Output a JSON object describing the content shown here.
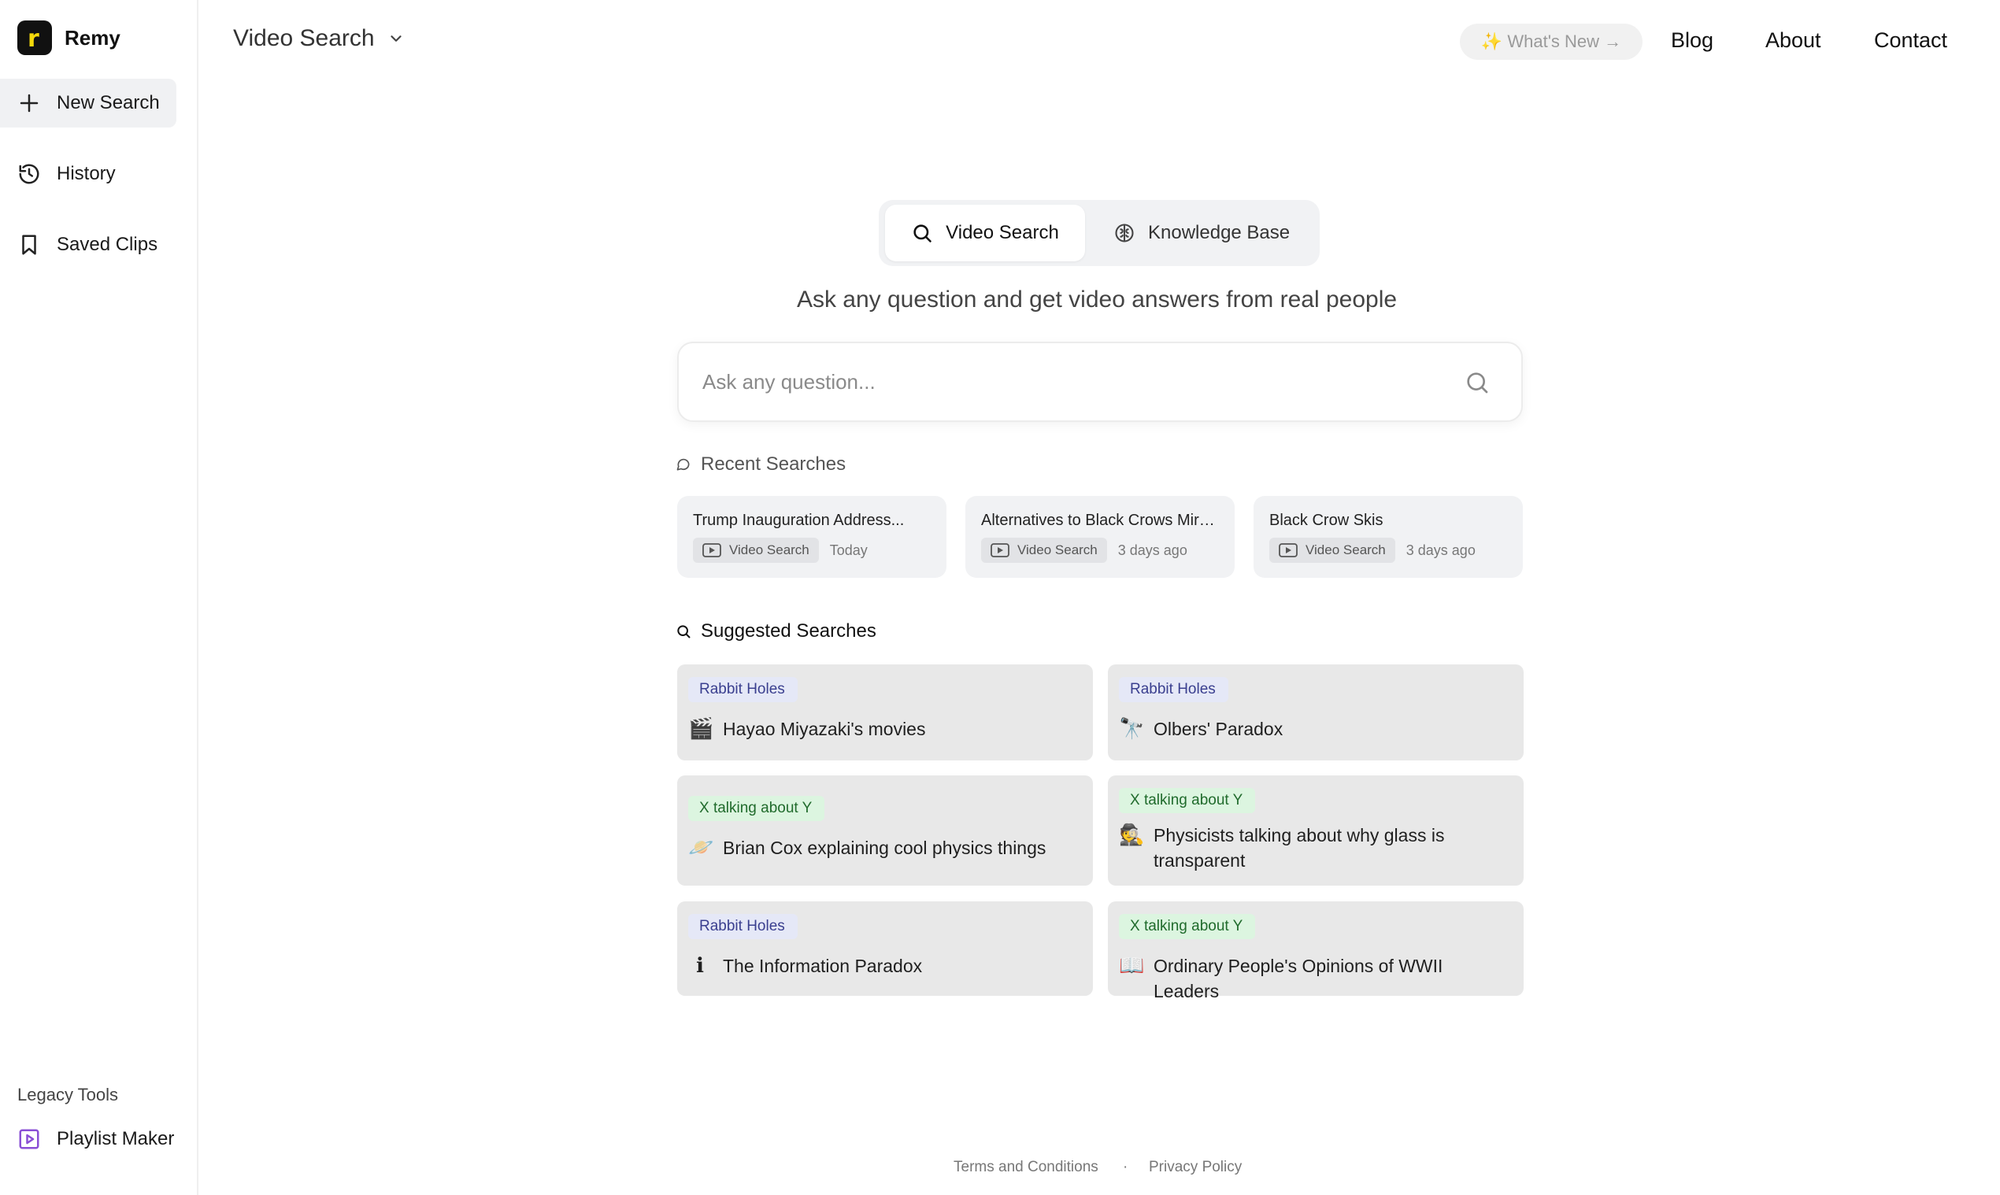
{
  "brand": {
    "name": "Remy",
    "logo_letter": "r"
  },
  "sidebar": {
    "items": [
      {
        "label": "New Search",
        "icon": "plus-icon",
        "active": true
      },
      {
        "label": "History",
        "icon": "history-icon"
      },
      {
        "label": "Saved Clips",
        "icon": "bookmark-icon"
      }
    ],
    "legacy_label": "Legacy Tools",
    "legacy_items": [
      {
        "label": "Playlist Maker",
        "icon": "play-square-icon"
      }
    ]
  },
  "header": {
    "mode_label": "Video Search",
    "whats_new": "✨ What's New →",
    "nav": [
      "Blog",
      "About",
      "Contact"
    ]
  },
  "mode_tabs": [
    {
      "label": "Video Search",
      "icon": "search-icon",
      "active": true
    },
    {
      "label": "Knowledge Base",
      "icon": "brain-icon"
    }
  ],
  "tagline": "Ask any question and get video answers from real people",
  "search": {
    "placeholder": "Ask any question...",
    "value": ""
  },
  "recent": {
    "title": "Recent Searches",
    "items": [
      {
        "title": "Trump Inauguration Address...",
        "type": "Video Search",
        "time": "Today"
      },
      {
        "title": "Alternatives to Black Crows Miru...",
        "type": "Video Search",
        "time": "3 days ago"
      },
      {
        "title": "Black Crow Skis",
        "type": "Video Search",
        "time": "3 days ago"
      }
    ]
  },
  "suggested": {
    "title": "Suggested Searches",
    "items": [
      {
        "category": "Rabbit Holes",
        "emoji": "🎬",
        "text": "Hayao Miyazaki's movies"
      },
      {
        "category": "Rabbit Holes",
        "emoji": "🔭",
        "text": "Olbers' Paradox"
      },
      {
        "category": "X talking about Y",
        "emoji": "🪐",
        "text": "Brian Cox explaining cool physics things"
      },
      {
        "category": "X talking about Y",
        "emoji": "🕵",
        "text": "Physicists talking about why glass is transparent"
      },
      {
        "category": "Rabbit Holes",
        "emoji": "ℹ",
        "text": "The Information Paradox"
      },
      {
        "category": "X talking about Y",
        "emoji": "📖",
        "text": "Ordinary People's Opinions of WWII Leaders"
      }
    ]
  },
  "footer": {
    "terms": "Terms and Conditions",
    "separator": "·",
    "privacy": "Privacy Policy"
  }
}
